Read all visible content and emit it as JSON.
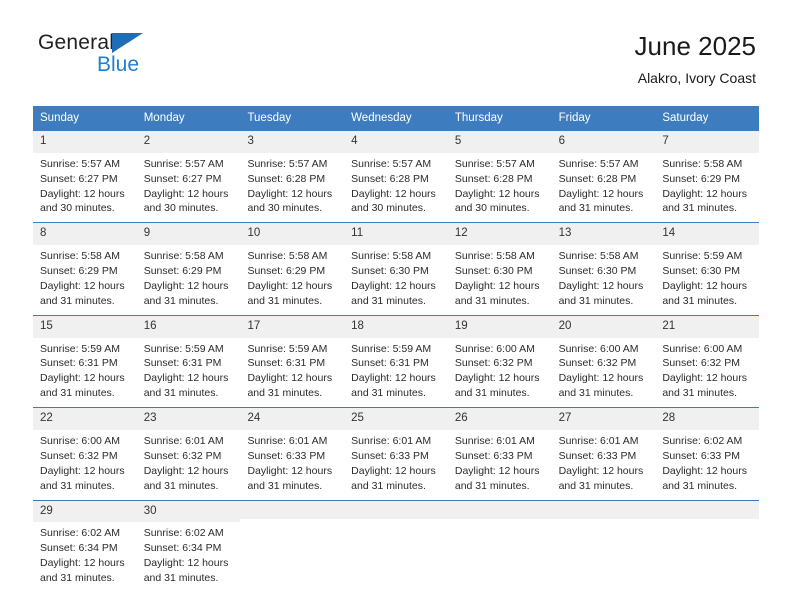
{
  "logo": {
    "word1": "General",
    "word2": "Blue",
    "triangle_color": "#1f6eb5",
    "word2_color": "#1f7fd0"
  },
  "header": {
    "title": "June 2025",
    "subtitle": "Alakro, Ivory Coast"
  },
  "theme": {
    "header_row_bg": "#3d7dbf",
    "day_number_bg": "#f0f0f0",
    "row_divider": "#3d7dbf",
    "text": "#2b2b2b"
  },
  "weekdays": [
    "Sunday",
    "Monday",
    "Tuesday",
    "Wednesday",
    "Thursday",
    "Friday",
    "Saturday"
  ],
  "weeks": [
    [
      {
        "day": "1",
        "sunrise": "Sunrise: 5:57 AM",
        "sunset": "Sunset: 6:27 PM",
        "daylight1": "Daylight: 12 hours",
        "daylight2": "and 30 minutes."
      },
      {
        "day": "2",
        "sunrise": "Sunrise: 5:57 AM",
        "sunset": "Sunset: 6:27 PM",
        "daylight1": "Daylight: 12 hours",
        "daylight2": "and 30 minutes."
      },
      {
        "day": "3",
        "sunrise": "Sunrise: 5:57 AM",
        "sunset": "Sunset: 6:28 PM",
        "daylight1": "Daylight: 12 hours",
        "daylight2": "and 30 minutes."
      },
      {
        "day": "4",
        "sunrise": "Sunrise: 5:57 AM",
        "sunset": "Sunset: 6:28 PM",
        "daylight1": "Daylight: 12 hours",
        "daylight2": "and 30 minutes."
      },
      {
        "day": "5",
        "sunrise": "Sunrise: 5:57 AM",
        "sunset": "Sunset: 6:28 PM",
        "daylight1": "Daylight: 12 hours",
        "daylight2": "and 30 minutes."
      },
      {
        "day": "6",
        "sunrise": "Sunrise: 5:57 AM",
        "sunset": "Sunset: 6:28 PM",
        "daylight1": "Daylight: 12 hours",
        "daylight2": "and 31 minutes."
      },
      {
        "day": "7",
        "sunrise": "Sunrise: 5:58 AM",
        "sunset": "Sunset: 6:29 PM",
        "daylight1": "Daylight: 12 hours",
        "daylight2": "and 31 minutes."
      }
    ],
    [
      {
        "day": "8",
        "sunrise": "Sunrise: 5:58 AM",
        "sunset": "Sunset: 6:29 PM",
        "daylight1": "Daylight: 12 hours",
        "daylight2": "and 31 minutes."
      },
      {
        "day": "9",
        "sunrise": "Sunrise: 5:58 AM",
        "sunset": "Sunset: 6:29 PM",
        "daylight1": "Daylight: 12 hours",
        "daylight2": "and 31 minutes."
      },
      {
        "day": "10",
        "sunrise": "Sunrise: 5:58 AM",
        "sunset": "Sunset: 6:29 PM",
        "daylight1": "Daylight: 12 hours",
        "daylight2": "and 31 minutes."
      },
      {
        "day": "11",
        "sunrise": "Sunrise: 5:58 AM",
        "sunset": "Sunset: 6:30 PM",
        "daylight1": "Daylight: 12 hours",
        "daylight2": "and 31 minutes."
      },
      {
        "day": "12",
        "sunrise": "Sunrise: 5:58 AM",
        "sunset": "Sunset: 6:30 PM",
        "daylight1": "Daylight: 12 hours",
        "daylight2": "and 31 minutes."
      },
      {
        "day": "13",
        "sunrise": "Sunrise: 5:58 AM",
        "sunset": "Sunset: 6:30 PM",
        "daylight1": "Daylight: 12 hours",
        "daylight2": "and 31 minutes."
      },
      {
        "day": "14",
        "sunrise": "Sunrise: 5:59 AM",
        "sunset": "Sunset: 6:30 PM",
        "daylight1": "Daylight: 12 hours",
        "daylight2": "and 31 minutes."
      }
    ],
    [
      {
        "day": "15",
        "sunrise": "Sunrise: 5:59 AM",
        "sunset": "Sunset: 6:31 PM",
        "daylight1": "Daylight: 12 hours",
        "daylight2": "and 31 minutes."
      },
      {
        "day": "16",
        "sunrise": "Sunrise: 5:59 AM",
        "sunset": "Sunset: 6:31 PM",
        "daylight1": "Daylight: 12 hours",
        "daylight2": "and 31 minutes."
      },
      {
        "day": "17",
        "sunrise": "Sunrise: 5:59 AM",
        "sunset": "Sunset: 6:31 PM",
        "daylight1": "Daylight: 12 hours",
        "daylight2": "and 31 minutes."
      },
      {
        "day": "18",
        "sunrise": "Sunrise: 5:59 AM",
        "sunset": "Sunset: 6:31 PM",
        "daylight1": "Daylight: 12 hours",
        "daylight2": "and 31 minutes."
      },
      {
        "day": "19",
        "sunrise": "Sunrise: 6:00 AM",
        "sunset": "Sunset: 6:32 PM",
        "daylight1": "Daylight: 12 hours",
        "daylight2": "and 31 minutes."
      },
      {
        "day": "20",
        "sunrise": "Sunrise: 6:00 AM",
        "sunset": "Sunset: 6:32 PM",
        "daylight1": "Daylight: 12 hours",
        "daylight2": "and 31 minutes."
      },
      {
        "day": "21",
        "sunrise": "Sunrise: 6:00 AM",
        "sunset": "Sunset: 6:32 PM",
        "daylight1": "Daylight: 12 hours",
        "daylight2": "and 31 minutes."
      }
    ],
    [
      {
        "day": "22",
        "sunrise": "Sunrise: 6:00 AM",
        "sunset": "Sunset: 6:32 PM",
        "daylight1": "Daylight: 12 hours",
        "daylight2": "and 31 minutes."
      },
      {
        "day": "23",
        "sunrise": "Sunrise: 6:01 AM",
        "sunset": "Sunset: 6:32 PM",
        "daylight1": "Daylight: 12 hours",
        "daylight2": "and 31 minutes."
      },
      {
        "day": "24",
        "sunrise": "Sunrise: 6:01 AM",
        "sunset": "Sunset: 6:33 PM",
        "daylight1": "Daylight: 12 hours",
        "daylight2": "and 31 minutes."
      },
      {
        "day": "25",
        "sunrise": "Sunrise: 6:01 AM",
        "sunset": "Sunset: 6:33 PM",
        "daylight1": "Daylight: 12 hours",
        "daylight2": "and 31 minutes."
      },
      {
        "day": "26",
        "sunrise": "Sunrise: 6:01 AM",
        "sunset": "Sunset: 6:33 PM",
        "daylight1": "Daylight: 12 hours",
        "daylight2": "and 31 minutes."
      },
      {
        "day": "27",
        "sunrise": "Sunrise: 6:01 AM",
        "sunset": "Sunset: 6:33 PM",
        "daylight1": "Daylight: 12 hours",
        "daylight2": "and 31 minutes."
      },
      {
        "day": "28",
        "sunrise": "Sunrise: 6:02 AM",
        "sunset": "Sunset: 6:33 PM",
        "daylight1": "Daylight: 12 hours",
        "daylight2": "and 31 minutes."
      }
    ],
    [
      {
        "day": "29",
        "sunrise": "Sunrise: 6:02 AM",
        "sunset": "Sunset: 6:34 PM",
        "daylight1": "Daylight: 12 hours",
        "daylight2": "and 31 minutes."
      },
      {
        "day": "30",
        "sunrise": "Sunrise: 6:02 AM",
        "sunset": "Sunset: 6:34 PM",
        "daylight1": "Daylight: 12 hours",
        "daylight2": "and 31 minutes."
      },
      {
        "day": "",
        "sunrise": "",
        "sunset": "",
        "daylight1": "",
        "daylight2": ""
      },
      {
        "day": "",
        "sunrise": "",
        "sunset": "",
        "daylight1": "",
        "daylight2": ""
      },
      {
        "day": "",
        "sunrise": "",
        "sunset": "",
        "daylight1": "",
        "daylight2": ""
      },
      {
        "day": "",
        "sunrise": "",
        "sunset": "",
        "daylight1": "",
        "daylight2": ""
      },
      {
        "day": "",
        "sunrise": "",
        "sunset": "",
        "daylight1": "",
        "daylight2": ""
      }
    ]
  ]
}
